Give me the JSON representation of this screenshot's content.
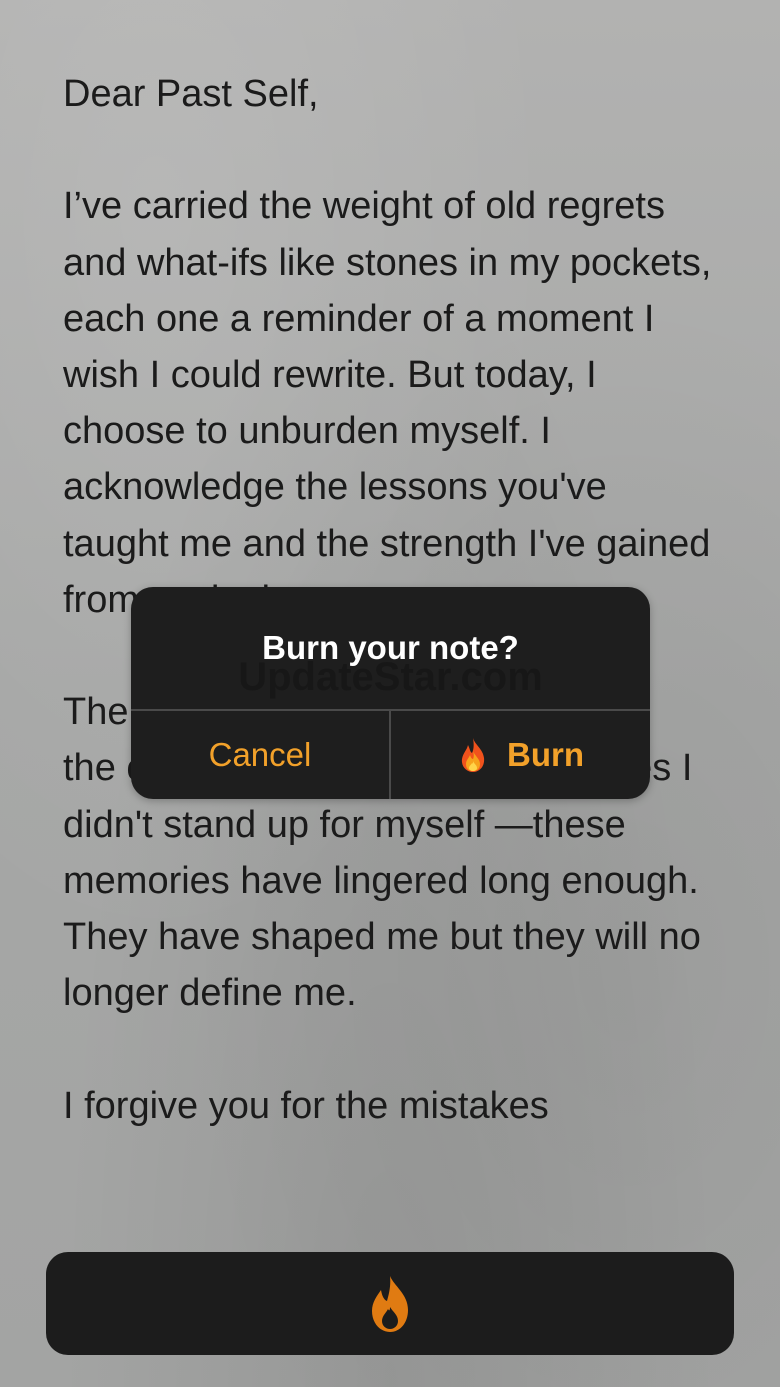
{
  "note": {
    "text": "Dear Past Self,\n\nI’ve carried the weight of old regrets and what-ifs like stones in my pockets, each one a reminder of a moment I wish I could rewrite. But today, I choose to unburden myself. I acknowledge the lessons you've taught me and the strength I've gained from each cha\n\nThe\nthe opportunities I missed, the times I didn't stand up for myself —these memories have lingered long enough. They have shaped me but they will no longer define me.\n\nI forgive you for the mistakes"
  },
  "dialog": {
    "title": "Burn your note?",
    "watermark": "UpdateStar.com",
    "cancel_label": "Cancel",
    "burn_label": "Burn",
    "burn_icon": "fire-emoji-icon"
  },
  "bottom_bar": {
    "icon": "flame-icon"
  },
  "colors": {
    "accent": "#f2a12a",
    "dialog_bg": "#1e1e1e",
    "bar_bg": "#1c1c1c",
    "flame": "#e07b12"
  }
}
